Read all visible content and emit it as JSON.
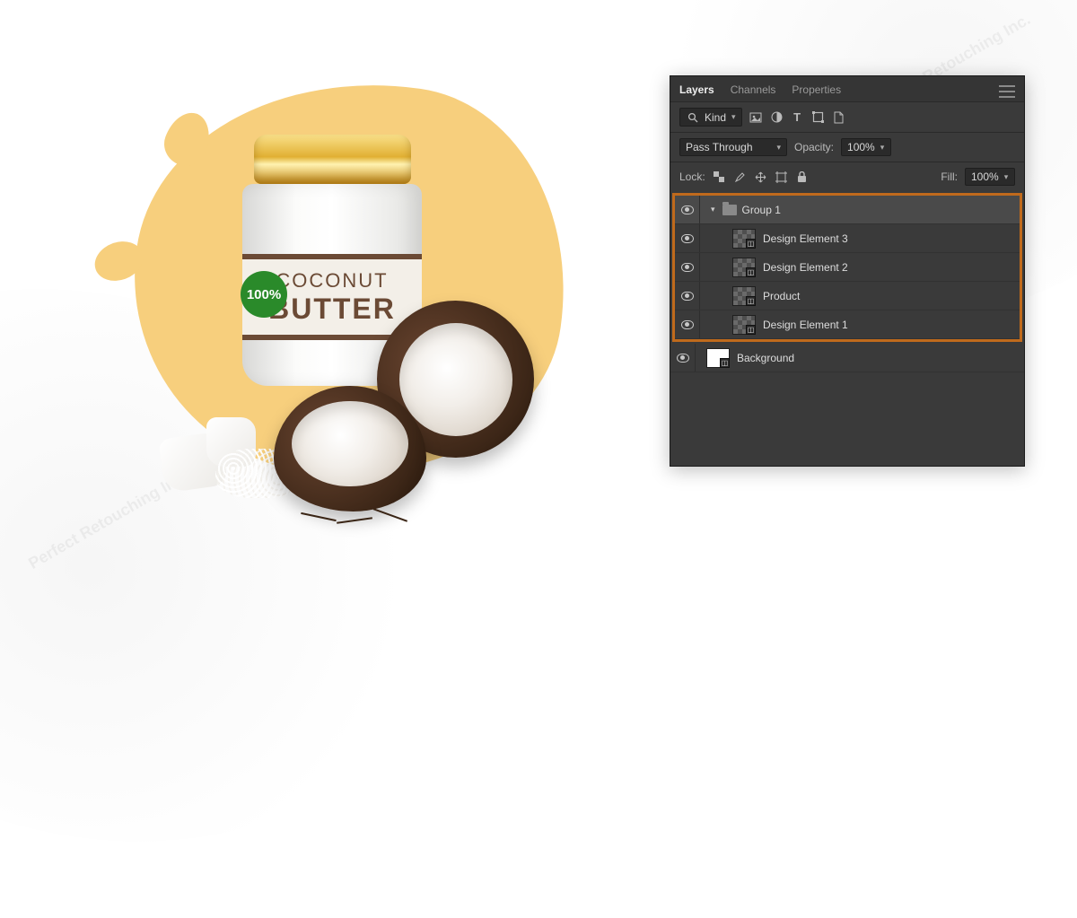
{
  "watermark": "Perfect Retouching Inc.",
  "product": {
    "label_line1": "COCONUT",
    "label_line2": "BUTTER",
    "badge": "100%"
  },
  "panel": {
    "tabs": {
      "layers": "Layers",
      "channels": "Channels",
      "properties": "Properties"
    },
    "filter": {
      "search": "Kind"
    },
    "blend": {
      "mode": "Pass Through",
      "opacity_label": "Opacity:",
      "opacity_value": "100%"
    },
    "lock": {
      "label": "Lock:",
      "fill_label": "Fill:",
      "fill_value": "100%"
    },
    "layers": [
      {
        "type": "group",
        "name": "Group 1"
      },
      {
        "type": "layer",
        "name": "Design Element 3"
      },
      {
        "type": "layer",
        "name": "Design Element 2"
      },
      {
        "type": "layer",
        "name": "Product"
      },
      {
        "type": "layer",
        "name": "Design Element 1"
      }
    ],
    "background_layer": "Background"
  }
}
